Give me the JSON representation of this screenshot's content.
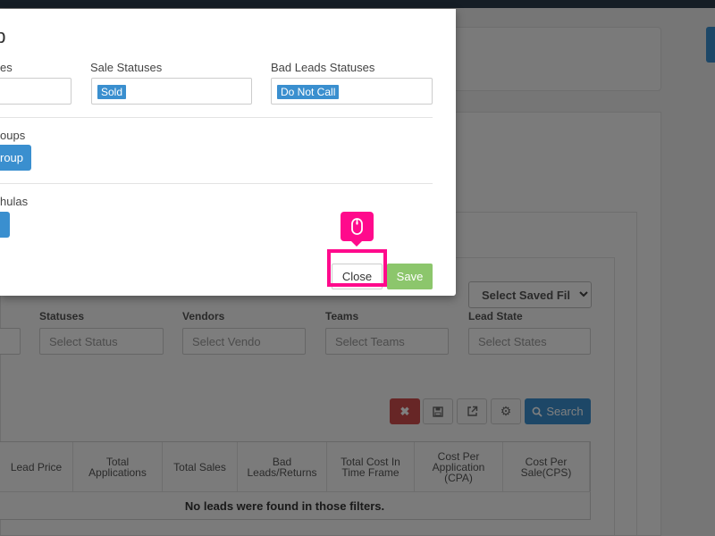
{
  "modal": {
    "title": "up",
    "columns": {
      "statuses_label": "es",
      "sale_statuses_label": "Sale Statuses",
      "sale_statuses_tag": "Sold",
      "bad_leads_label": "Bad Leads Statuses",
      "bad_leads_tag": "Do Not Call"
    },
    "groups_label": "oups",
    "group_button_label": "roup",
    "formulas_label": "hulas",
    "close_label": "Close",
    "save_label": "Save"
  },
  "filters": {
    "saved_filter_label": "Select Saved Fil",
    "statuses_label": "Statuses",
    "statuses_placeholder": "Select Status",
    "vendors_label": "Vendors",
    "vendors_placeholder": "Select Vendo",
    "teams_label": "Teams",
    "teams_placeholder": "Select Teams",
    "lead_state_label": "Lead State",
    "lead_state_placeholder": "Select States"
  },
  "toolbar": {
    "clear_icon": "x-icon",
    "save_icon": "floppy-icon",
    "export_icon": "external-link-icon",
    "settings_icon": "gear-icon",
    "search_label": "Search"
  },
  "table": {
    "headers": [
      "Lead Price",
      "Total Applications",
      "Total Sales",
      "Bad Leads/Returns",
      "Total Cost In Time Frame",
      "Cost Per Application (CPA)",
      "Cost Per Sale(CPS)"
    ],
    "empty_message": "No leads were found in those filters."
  },
  "colors": {
    "accent_blue": "#3a8fcf",
    "save_green": "#8cc66c",
    "danger_red": "#cf4d4d",
    "highlight_pink": "#ff0a8c"
  },
  "highlight": {
    "icon": "mouse-icon"
  }
}
